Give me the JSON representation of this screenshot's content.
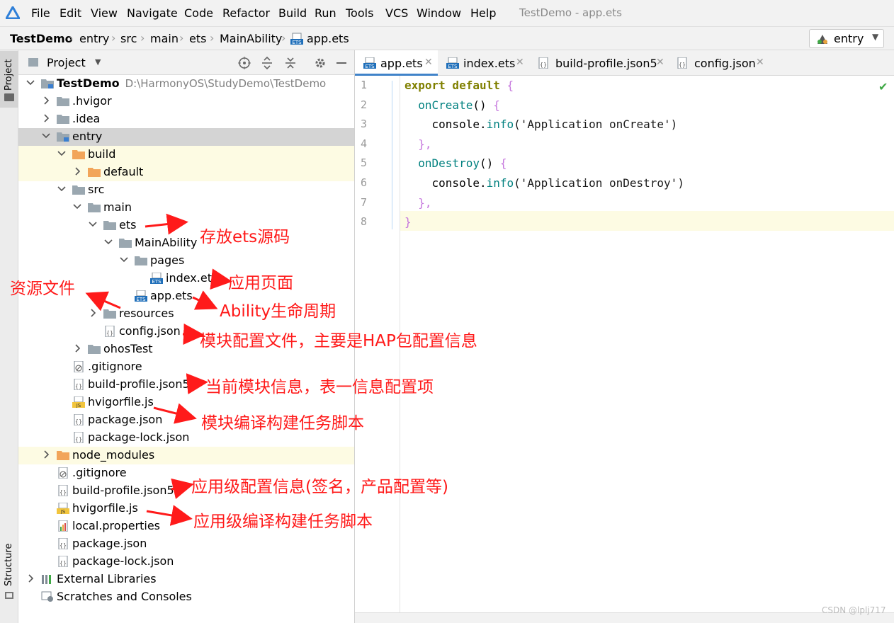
{
  "menubar": {
    "items": [
      "File",
      "Edit",
      "View",
      "Navigate",
      "Code",
      "Refactor",
      "Build",
      "Run",
      "Tools",
      "VCS",
      "Window",
      "Help"
    ],
    "window_title": "TestDemo - app.ets"
  },
  "breadcrumb": [
    "TestDemo",
    "entry",
    "src",
    "main",
    "ets",
    "MainAbility",
    "app.ets"
  ],
  "run_config": {
    "label": "entry"
  },
  "tool_strip": {
    "project": "Project",
    "structure": "Structure"
  },
  "project_panel": {
    "title": "Project"
  },
  "tree": [
    {
      "label": "TestDemo",
      "path": "D:\\HarmonyOS\\StudyDemo\\TestDemo",
      "depth": 0,
      "arrow": "down",
      "icon": "module-folder-icon",
      "bold": true
    },
    {
      "label": ".hvigor",
      "depth": 1,
      "arrow": "right",
      "icon": "folder-icon"
    },
    {
      "label": ".idea",
      "depth": 1,
      "arrow": "right",
      "icon": "folder-icon"
    },
    {
      "label": "entry",
      "depth": 1,
      "arrow": "down",
      "icon": "module-folder-icon",
      "state": "selected"
    },
    {
      "label": "build",
      "depth": 2,
      "arrow": "down",
      "icon": "excluded-folder-icon",
      "state": "excluded"
    },
    {
      "label": "default",
      "depth": 3,
      "arrow": "right",
      "icon": "excluded-folder-icon",
      "state": "excluded"
    },
    {
      "label": "src",
      "depth": 2,
      "arrow": "down",
      "icon": "folder-icon"
    },
    {
      "label": "main",
      "depth": 3,
      "arrow": "down",
      "icon": "folder-icon"
    },
    {
      "label": "ets",
      "depth": 4,
      "arrow": "down",
      "icon": "folder-icon"
    },
    {
      "label": "MainAbility",
      "depth": 5,
      "arrow": "down",
      "icon": "folder-icon"
    },
    {
      "label": "pages",
      "depth": 6,
      "arrow": "down",
      "icon": "folder-icon"
    },
    {
      "label": "index.ets",
      "depth": 7,
      "arrow": "none",
      "icon": "ets-file-icon"
    },
    {
      "label": "app.ets",
      "depth": 6,
      "arrow": "none",
      "icon": "ets-file-icon"
    },
    {
      "label": "resources",
      "depth": 4,
      "arrow": "right",
      "icon": "folder-icon"
    },
    {
      "label": "config.json",
      "depth": 4,
      "arrow": "none",
      "icon": "json-file-icon"
    },
    {
      "label": "ohosTest",
      "depth": 3,
      "arrow": "right",
      "icon": "folder-icon"
    },
    {
      "label": ".gitignore",
      "depth": 2,
      "arrow": "none",
      "icon": "ignore-file-icon"
    },
    {
      "label": "build-profile.json5",
      "depth": 2,
      "arrow": "none",
      "icon": "json-file-icon"
    },
    {
      "label": "hvigorfile.js",
      "depth": 2,
      "arrow": "none",
      "icon": "js-file-icon"
    },
    {
      "label": "package.json",
      "depth": 2,
      "arrow": "none",
      "icon": "json-file-icon"
    },
    {
      "label": "package-lock.json",
      "depth": 2,
      "arrow": "none",
      "icon": "json-file-icon"
    },
    {
      "label": "node_modules",
      "depth": 1,
      "arrow": "right",
      "icon": "excluded-folder-icon",
      "state": "excluded"
    },
    {
      "label": ".gitignore",
      "depth": 1,
      "arrow": "none",
      "icon": "ignore-file-icon"
    },
    {
      "label": "build-profile.json5",
      "depth": 1,
      "arrow": "none",
      "icon": "json-file-icon"
    },
    {
      "label": "hvigorfile.js",
      "depth": 1,
      "arrow": "none",
      "icon": "js-file-icon"
    },
    {
      "label": "local.properties",
      "depth": 1,
      "arrow": "none",
      "icon": "properties-file-icon"
    },
    {
      "label": "package.json",
      "depth": 1,
      "arrow": "none",
      "icon": "json-file-icon"
    },
    {
      "label": "package-lock.json",
      "depth": 1,
      "arrow": "none",
      "icon": "json-file-icon"
    },
    {
      "label": "External Libraries",
      "depth": 0,
      "arrow": "right",
      "icon": "library-icon"
    },
    {
      "label": "Scratches and Consoles",
      "depth": 0,
      "arrow": "none",
      "icon": "scratches-icon"
    }
  ],
  "tabs": [
    {
      "label": "app.ets",
      "icon": "ets-file-icon",
      "active": true
    },
    {
      "label": "index.ets",
      "icon": "ets-file-icon"
    },
    {
      "label": "build-profile.json5",
      "icon": "json-file-icon"
    },
    {
      "label": "config.json",
      "icon": "json-file-icon"
    }
  ],
  "editor": {
    "line_numbers": [
      "1",
      "2",
      "3",
      "4",
      "5",
      "6",
      "7",
      "8"
    ],
    "current_line": "8",
    "lines": [
      [
        {
          "t": "export default ",
          "c": "kw"
        },
        {
          "t": "{",
          "c": "br"
        }
      ],
      [
        {
          "t": "  ",
          "c": ""
        },
        {
          "t": "onCreate",
          "c": "fn"
        },
        {
          "t": "() ",
          "c": ""
        },
        {
          "t": "{",
          "c": "br"
        }
      ],
      [
        {
          "t": "    console.",
          "c": ""
        },
        {
          "t": "info",
          "c": "fn"
        },
        {
          "t": "('Application onCreate')",
          "c": "str"
        }
      ],
      [
        {
          "t": "  ",
          "c": ""
        },
        {
          "t": "},",
          "c": "br"
        }
      ],
      [
        {
          "t": "  ",
          "c": ""
        },
        {
          "t": "onDestroy",
          "c": "fn"
        },
        {
          "t": "() ",
          "c": ""
        },
        {
          "t": "{",
          "c": "br"
        }
      ],
      [
        {
          "t": "    console.",
          "c": ""
        },
        {
          "t": "info",
          "c": "fn"
        },
        {
          "t": "('Application onDestroy')",
          "c": "str"
        }
      ],
      [
        {
          "t": "  ",
          "c": ""
        },
        {
          "t": "},",
          "c": "br"
        }
      ],
      [
        {
          "t": "}",
          "c": "br"
        }
      ]
    ]
  },
  "annotations": [
    {
      "text": "存放ets源码",
      "target": "ets"
    },
    {
      "text": "应用页面",
      "target": "index.ets"
    },
    {
      "text": "资源文件",
      "target": "resources"
    },
    {
      "text": "Ability生命周期",
      "target": "app.ets"
    },
    {
      "text": "模块配置文件，主要是HAP包配置信息",
      "target": "config.json"
    },
    {
      "text": "当前模块信息，表一信息配置项",
      "target": "build-profile.json5"
    },
    {
      "text": "模块编译构建任务脚本",
      "target": "hvigorfile.js"
    },
    {
      "text": "应用级配置信息(签名，产品配置等)",
      "target": "build-profile.json5"
    },
    {
      "text": "应用级编译构建任务脚本",
      "target": "hvigorfile.js"
    }
  ],
  "watermark": "CSDN @lplj717",
  "colors": {
    "accent": "#4083c9",
    "annotation": "#ff1a1a",
    "keyword": "#808000",
    "function": "#00807f",
    "selection": "#d4d4d4",
    "excluded": "#fdfbe3",
    "folder": "#9aa7b0",
    "excluded_folder": "#f2a55a"
  }
}
